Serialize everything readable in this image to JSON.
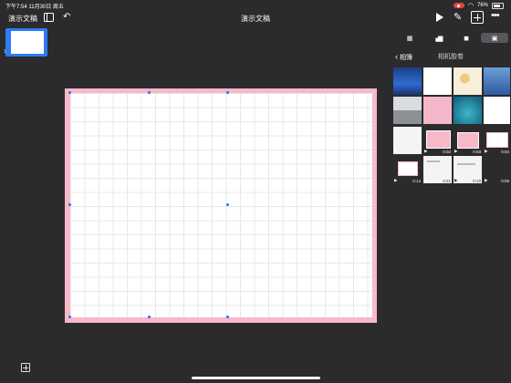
{
  "status": {
    "time_date": "下午7:54   11月30日 周五",
    "battery": "76%"
  },
  "toolbar": {
    "doc_title_left": "演示文稿",
    "doc_title_center": "演示文稿"
  },
  "navigator": {
    "slide_number": "1"
  },
  "panel": {
    "back_label": "相簿",
    "title": "相机胶卷",
    "tabs": [
      {
        "name": "table-icon",
        "glyph": "▦"
      },
      {
        "name": "chart-icon",
        "glyph": "▗▆"
      },
      {
        "name": "shape-icon",
        "glyph": "◼"
      },
      {
        "name": "media-icon",
        "glyph": "▣"
      }
    ],
    "videos": [
      {
        "duration": "0:02"
      },
      {
        "duration": "0:03"
      },
      {
        "duration": "0:04"
      },
      {
        "duration": "0:14"
      },
      {
        "duration": "0:21"
      },
      {
        "duration": "0:19"
      },
      {
        "duration": "0:08"
      }
    ]
  },
  "colors": {
    "accent": "#2d7cf6",
    "slide_border": "#f7b8c8",
    "background": "#2b2b2d"
  }
}
